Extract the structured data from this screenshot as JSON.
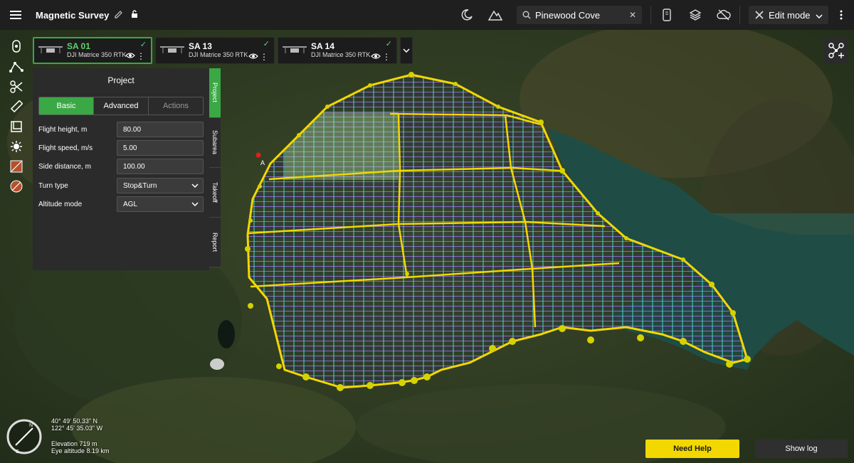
{
  "app": {
    "title": "Magnetic Survey",
    "search_value": "Pinewood Cove",
    "edit_mode_label": "Edit mode"
  },
  "drones": [
    {
      "name": "SA 01",
      "model": "DJI Matrice 350 RTK",
      "active": true
    },
    {
      "name": "SA 13",
      "model": "DJI Matrice 350 RTK",
      "active": false
    },
    {
      "name": "SA 14",
      "model": "DJI Matrice 350 RTK",
      "active": false
    }
  ],
  "panel": {
    "title": "Project",
    "tabs": [
      "Basic",
      "Advanced",
      "Actions"
    ],
    "fields": [
      {
        "label": "Flight height, m",
        "value": "80.00"
      },
      {
        "label": "Flight speed, m/s",
        "value": "5.00"
      },
      {
        "label": "Side distance, m",
        "value": "100.00"
      },
      {
        "label": "Turn type",
        "value": "Stop&Turn"
      },
      {
        "label": "Altitude mode",
        "value": "AGL"
      }
    ],
    "side_tabs": [
      "Project",
      "Subarea",
      "Takeoff",
      "Report"
    ]
  },
  "map": {
    "marker_label": "A",
    "latitude": "40° 49' 50.33\" N",
    "longitude": "122° 45' 35.03\" W",
    "elevation": "Elevation 719 m",
    "eye_altitude": "Eye altitude 8.19 km",
    "compass_letters": {
      "north": "N",
      "south": "S"
    }
  },
  "buttons": {
    "need_help": "Need Help",
    "show_log": "Show log"
  },
  "colors": {
    "accent_green": "#3aa845",
    "boundary_yellow": "#f2d800",
    "grid_cyan": "#4fd2c8",
    "grid_violet": "#9a6cf0"
  }
}
